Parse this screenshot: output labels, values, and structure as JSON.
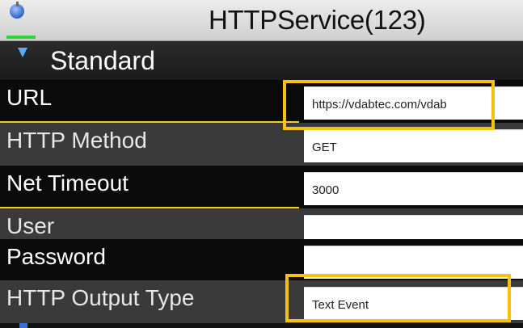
{
  "window": {
    "title": "HTTPService(123)",
    "app_icon": "app-globe-icon"
  },
  "section": {
    "label": "Standard",
    "icon": "expand-triangle-icon"
  },
  "rows": [
    {
      "label": "URL",
      "value": "https://vdabtec.com/vdab"
    },
    {
      "label": "HTTP Method",
      "value": "GET"
    },
    {
      "label": "Net Timeout",
      "value": "3000"
    },
    {
      "label": "User",
      "value": ""
    },
    {
      "label": "Password",
      "value": ""
    },
    {
      "label": "HTTP Output Type",
      "value": "Text Event"
    }
  ],
  "colors": {
    "highlight": "#f7c10f",
    "underline": "#f2d01a",
    "accent_green": "#2fd63a",
    "accent_blue": "#5fa8ff"
  }
}
